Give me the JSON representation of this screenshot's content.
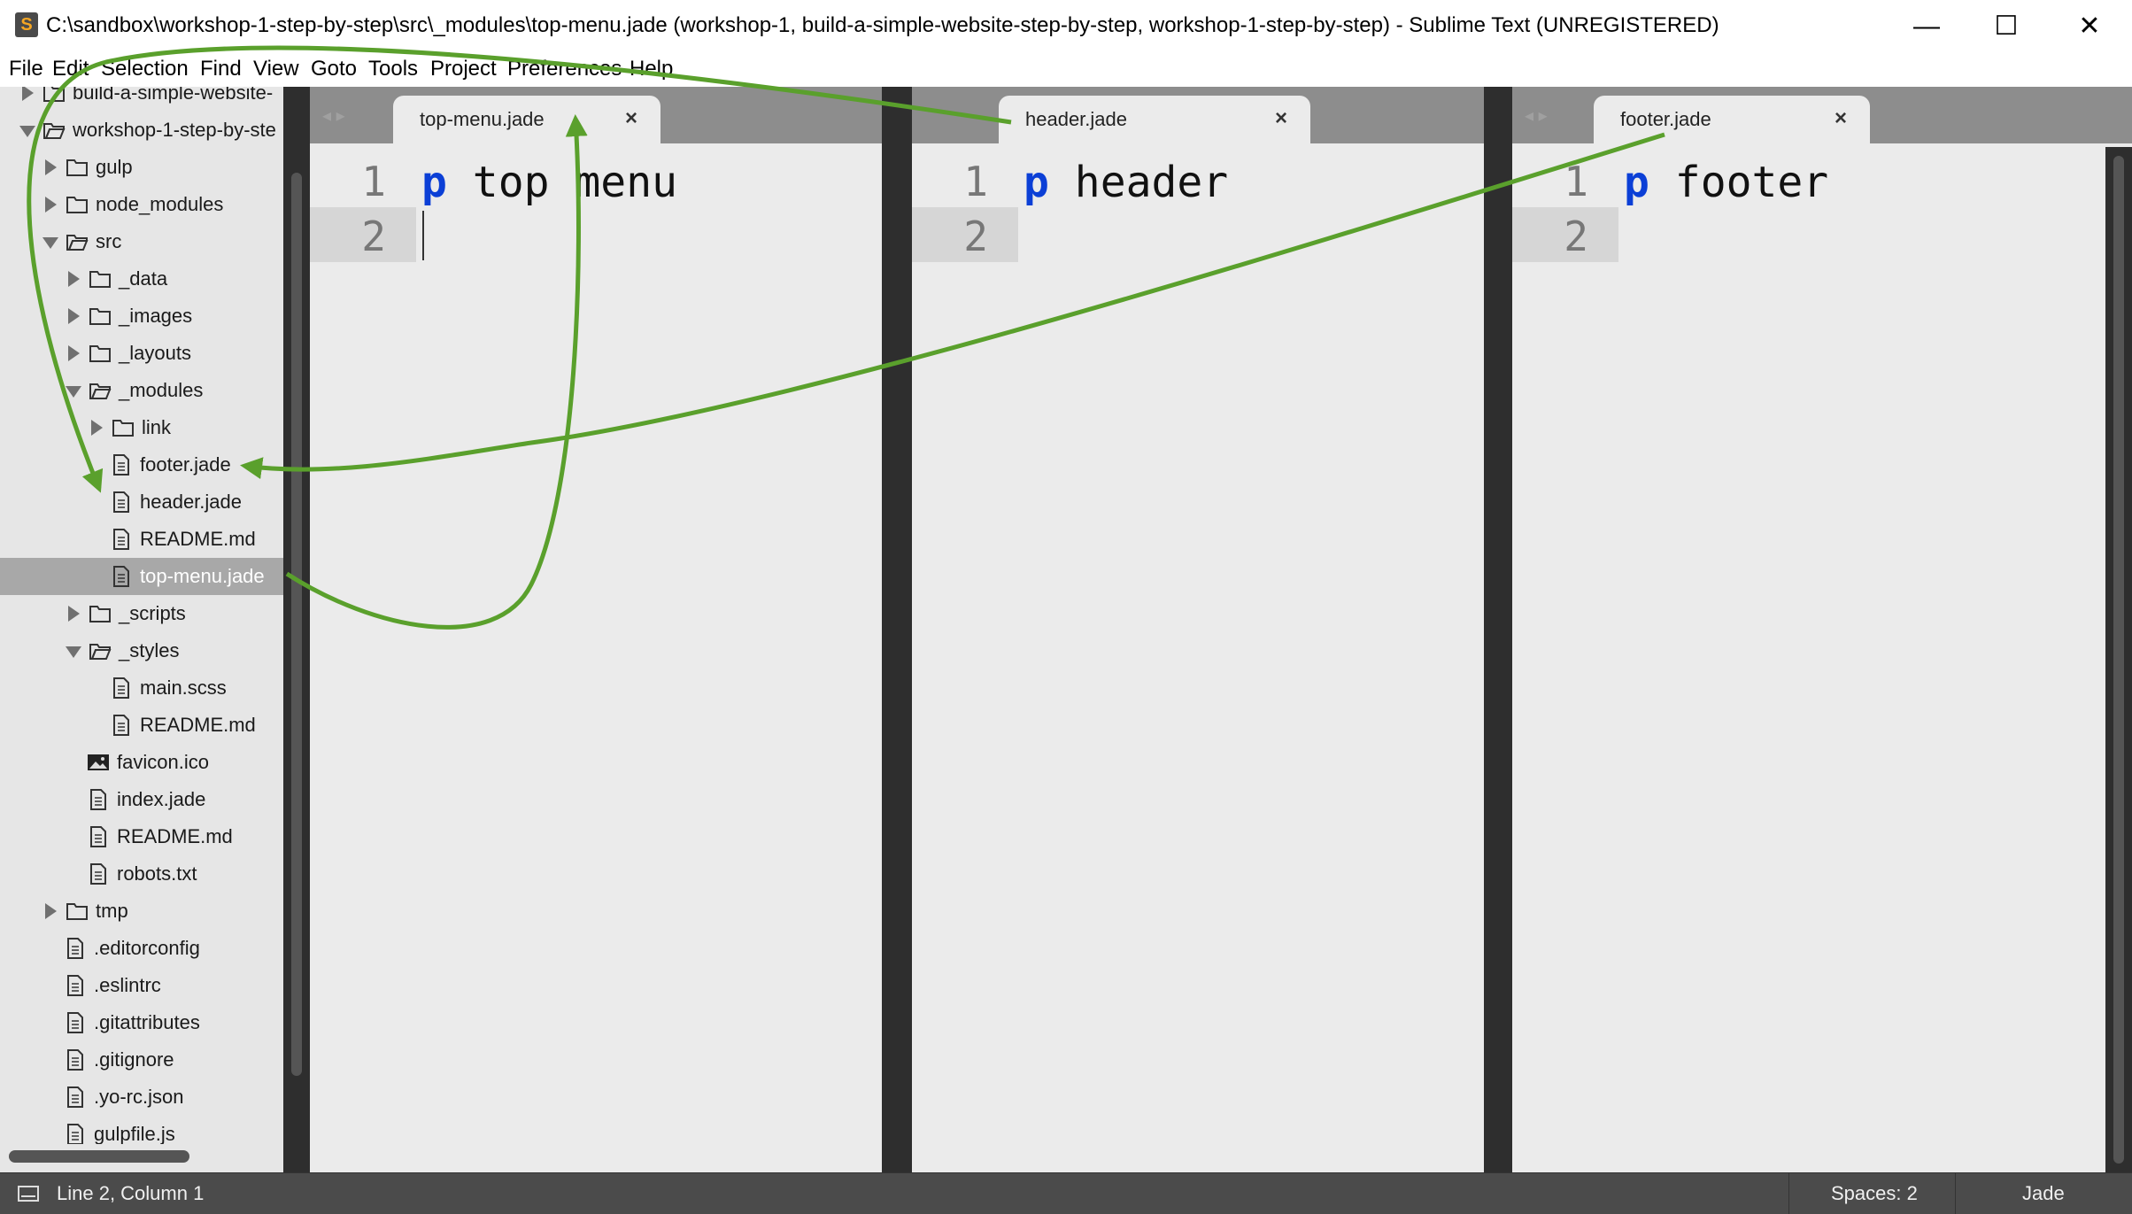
{
  "window": {
    "title": "C:\\sandbox\\workshop-1-step-by-step\\src\\_modules\\top-menu.jade (workshop-1, build-a-simple-website-step-by-step, workshop-1-step-by-step) - Sublime Text (UNREGISTERED)",
    "app_icon_letter": "S",
    "minimize_glyph": "—",
    "maximize_glyph": "☐",
    "close_glyph": "✕"
  },
  "menu": [
    "File",
    "Edit",
    "Selection",
    "Find",
    "View",
    "Goto",
    "Tools",
    "Project",
    "Preferences",
    "Help"
  ],
  "sidebar": {
    "items": [
      {
        "label": "build-a-simple-website-",
        "type": "folder",
        "state": "closed",
        "depth": 0
      },
      {
        "label": "workshop-1-step-by-ste",
        "type": "folder",
        "state": "open",
        "depth": 0
      },
      {
        "label": "gulp",
        "type": "folder",
        "state": "closed",
        "depth": 1
      },
      {
        "label": "node_modules",
        "type": "folder",
        "state": "closed",
        "depth": 1
      },
      {
        "label": "src",
        "type": "folder",
        "state": "open",
        "depth": 1
      },
      {
        "label": "_data",
        "type": "folder",
        "state": "closed",
        "depth": 2
      },
      {
        "label": "_images",
        "type": "folder",
        "state": "closed",
        "depth": 2
      },
      {
        "label": "_layouts",
        "type": "folder",
        "state": "closed",
        "depth": 2
      },
      {
        "label": "_modules",
        "type": "folder",
        "state": "open",
        "depth": 2
      },
      {
        "label": "link",
        "type": "folder",
        "state": "closed",
        "depth": 3
      },
      {
        "label": "footer.jade",
        "type": "file",
        "depth": 3
      },
      {
        "label": "header.jade",
        "type": "file",
        "depth": 3
      },
      {
        "label": "README.md",
        "type": "file",
        "depth": 3
      },
      {
        "label": "top-menu.jade",
        "type": "file",
        "depth": 3,
        "selected": true
      },
      {
        "label": "_scripts",
        "type": "folder",
        "state": "closed",
        "depth": 2
      },
      {
        "label": "_styles",
        "type": "folder",
        "state": "open",
        "depth": 2
      },
      {
        "label": "main.scss",
        "type": "file",
        "depth": 3
      },
      {
        "label": "README.md",
        "type": "file",
        "depth": 3
      },
      {
        "label": "favicon.ico",
        "type": "image",
        "depth": 2
      },
      {
        "label": "index.jade",
        "type": "file",
        "depth": 2
      },
      {
        "label": "README.md",
        "type": "file",
        "depth": 2
      },
      {
        "label": "robots.txt",
        "type": "file",
        "depth": 2
      },
      {
        "label": "tmp",
        "type": "folder",
        "state": "closed",
        "depth": 1
      },
      {
        "label": ".editorconfig",
        "type": "file",
        "depth": 1
      },
      {
        "label": ".eslintrc",
        "type": "file",
        "depth": 1
      },
      {
        "label": ".gitattributes",
        "type": "file",
        "depth": 1
      },
      {
        "label": ".gitignore",
        "type": "file",
        "depth": 1
      },
      {
        "label": ".yo-rc.json",
        "type": "file",
        "depth": 1
      },
      {
        "label": "gulpfile.js",
        "type": "file",
        "depth": 1
      }
    ]
  },
  "groups": [
    {
      "tab": "top-menu.jade",
      "close": "×",
      "lines": [
        "1",
        "2"
      ],
      "code_keyword": "p",
      "code_text": " top menu",
      "active": true
    },
    {
      "tab": "header.jade",
      "close": "×",
      "lines": [
        "1",
        "2"
      ],
      "code_keyword": "p",
      "code_text": " header",
      "active": false
    },
    {
      "tab": "footer.jade",
      "close": "×",
      "lines": [
        "1",
        "2"
      ],
      "code_keyword": "p",
      "code_text": " footer",
      "active": false
    }
  ],
  "status": {
    "position": "Line 2, Column 1",
    "indentation": "Spaces: 2",
    "syntax": "Jade"
  },
  "colors": {
    "annotation_arrow": "#5aa02c",
    "keyword": "#0b3fd6",
    "sidebar_bg": "#e6e6e6",
    "editor_bg": "#ebebeb",
    "statusbar_bg": "#4b4b4b"
  }
}
